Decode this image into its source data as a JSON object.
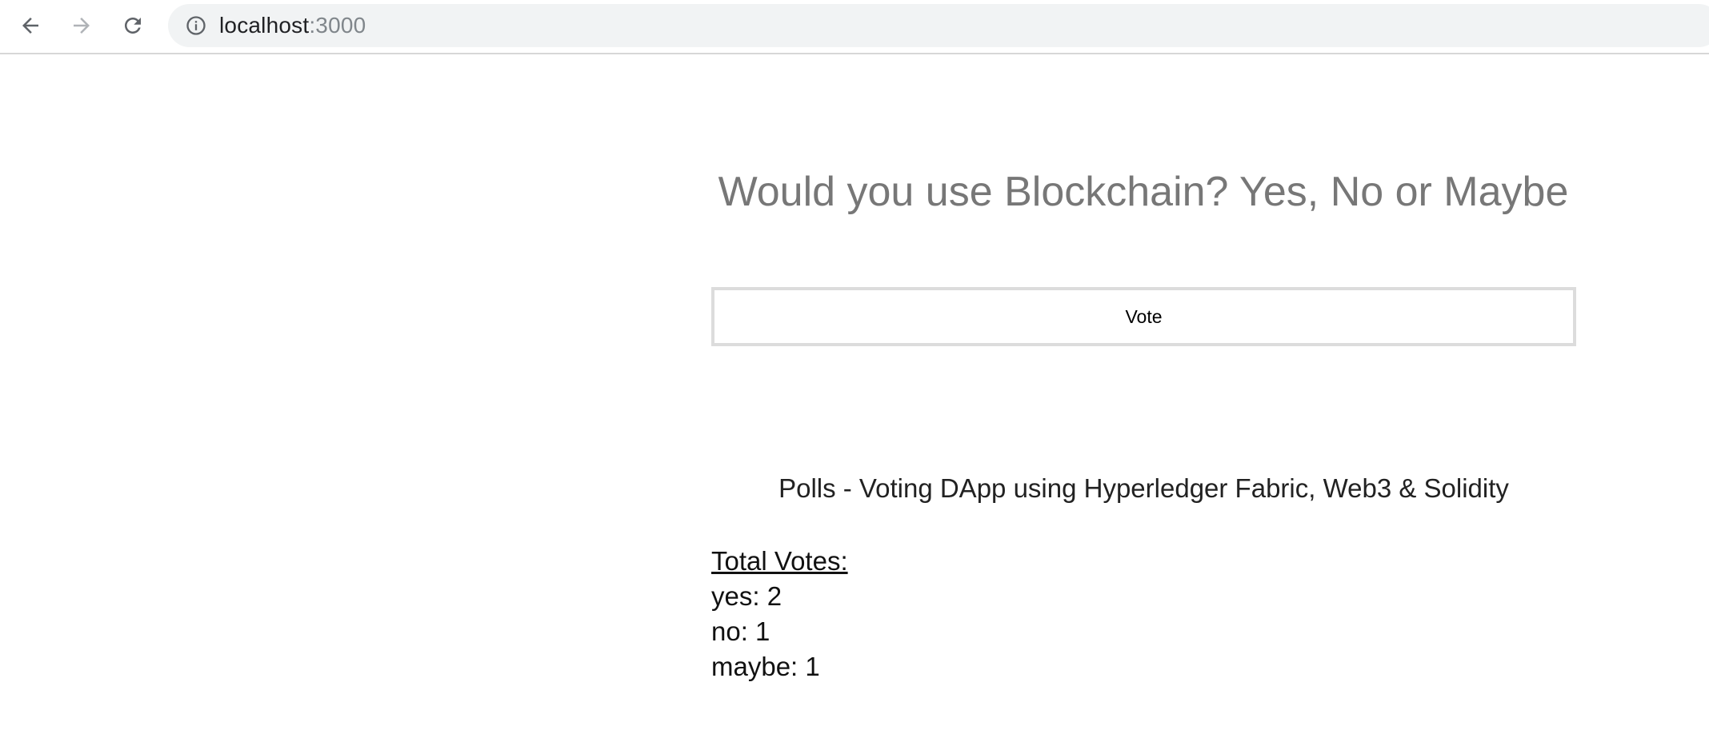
{
  "browser": {
    "url_host": "localhost",
    "url_port": ":3000"
  },
  "main": {
    "question": "Would you use Blockchain? Yes, No or Maybe",
    "vote_button_label": "Vote",
    "footer_title": "Polls - Voting DApp using Hyperledger Fabric, Web3 & Solidity"
  },
  "results": {
    "heading": "Total Votes:",
    "items": [
      {
        "label": "yes: 2"
      },
      {
        "label": "no: 1"
      },
      {
        "label": "maybe: 1"
      }
    ]
  }
}
